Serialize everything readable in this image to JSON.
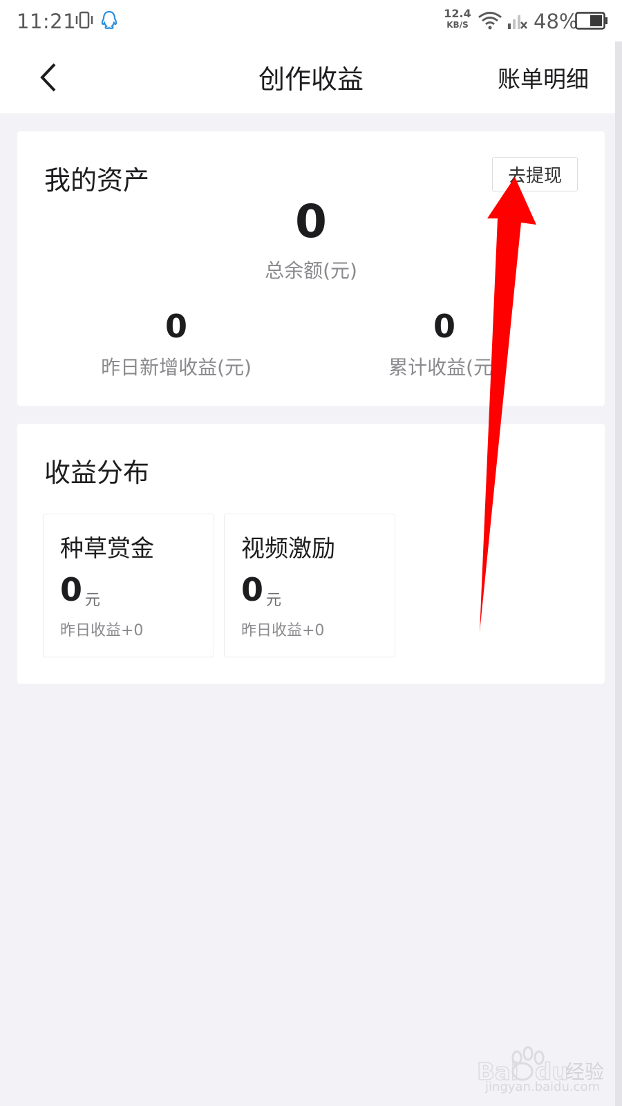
{
  "status_bar": {
    "time": "11:21",
    "net_speed_value": "12.4",
    "net_speed_unit": "KB/S",
    "battery_percent": "48%"
  },
  "header": {
    "title": "创作收益",
    "bill_link": "账单明细"
  },
  "assets": {
    "title": "我的资产",
    "withdraw_label": "去提现",
    "total_value": "0",
    "total_label": "总余额(元)",
    "yesterday_value": "0",
    "yesterday_label": "昨日新增收益(元)",
    "cumulative_value": "0",
    "cumulative_label": "累计收益(元)"
  },
  "distribution": {
    "title": "收益分布",
    "items": [
      {
        "name": "种草赏金",
        "amount": "0",
        "unit": "元",
        "yesterday": "昨日收益+0"
      },
      {
        "name": "视频激励",
        "amount": "0",
        "unit": "元",
        "yesterday": "昨日收益+0"
      }
    ]
  },
  "watermark": {
    "brand": "Baidu经验",
    "url": "jingyan.baidu.com"
  },
  "colors": {
    "background": "#f3f3f7",
    "card": "#ffffff",
    "annotation_arrow": "#ff0000",
    "muted_text": "#8a8a8e"
  }
}
